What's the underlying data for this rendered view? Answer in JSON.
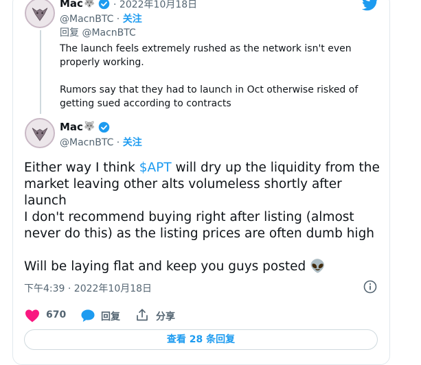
{
  "parent": {
    "name": "Mac",
    "date": "2022年10月18日",
    "handle": "@MacnBTC",
    "follow": "关注",
    "reply_prefix": "回复",
    "reply_to": "@MacnBTC",
    "para1": "The launch feels extremely rushed as the network isn't even properly working.",
    "para2": "Rumors say that they had to launch in Oct otherwise risked of getting sued according to contracts"
  },
  "tweet": {
    "name": "Mac",
    "handle": "@MacnBTC",
    "follow": "关注",
    "para1_before": "Either way I think ",
    "cashtag": "$APT",
    "para1_after": " will dry up the liquidity from the market leaving other alts volumeless shortly after launch",
    "para2": "I don't recommend buying right after listing (almost never do this) as the listing prices are often dumb high",
    "para3": "Will be laying flat and keep you guys posted",
    "emoji": "👽",
    "timestamp": "下午4:39 · 2022年10月18日",
    "likes": "670",
    "reply_label": "回复",
    "share_label": "分享",
    "view_replies": "查看 28 条回复"
  },
  "colors": {
    "accent": "#1d9bf0",
    "like": "#f91880",
    "muted": "#536471"
  },
  "icons": [
    "wolf-emoji-icon",
    "verified-badge-icon",
    "twitter-bird-icon",
    "info-icon",
    "heart-icon",
    "reply-icon",
    "share-icon",
    "alien-emoji-icon"
  ]
}
